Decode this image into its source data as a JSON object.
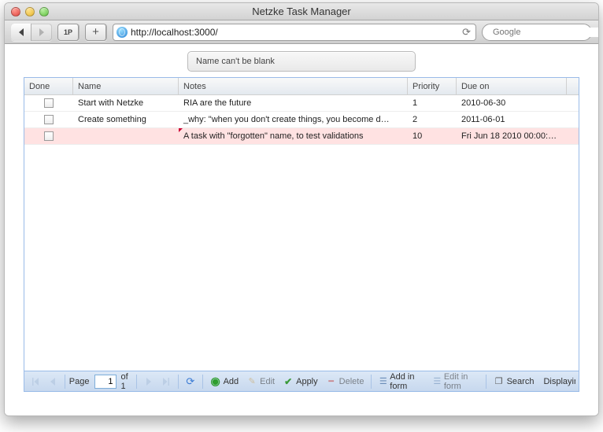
{
  "window": {
    "title": "Netzke Task Manager"
  },
  "browser": {
    "url": "http://localhost:3000/",
    "search_placeholder": "Google",
    "onep_label": "1P",
    "plus_label": "+"
  },
  "validation_message": "Name can't be blank",
  "grid": {
    "columns": {
      "done": "Done",
      "name": "Name",
      "notes": "Notes",
      "priority": "Priority",
      "due_on": "Due on"
    },
    "rows": [
      {
        "done": false,
        "name": "Start with Netzke",
        "notes": "RIA are the future",
        "priority": "1",
        "due_on": "2010-06-30",
        "invalid": false
      },
      {
        "done": false,
        "name": "Create something",
        "notes": "_why: \"when you don't create things, you become d…",
        "priority": "2",
        "due_on": "2011-06-01",
        "invalid": false
      },
      {
        "done": false,
        "name": "",
        "notes": "A task with \"forgotten\" name, to test validations",
        "priority": "10",
        "due_on": "Fri Jun 18 2010 00:00:…",
        "invalid": true
      }
    ]
  },
  "toolbar": {
    "page_label": "Page",
    "current_page": "1",
    "of_label": "of 1",
    "add": "Add",
    "edit": "Edit",
    "apply": "Apply",
    "delete": "Delete",
    "add_in_form": "Add in form",
    "edit_in_form": "Edit in form",
    "search": "Search",
    "displaying": "Displaying"
  }
}
